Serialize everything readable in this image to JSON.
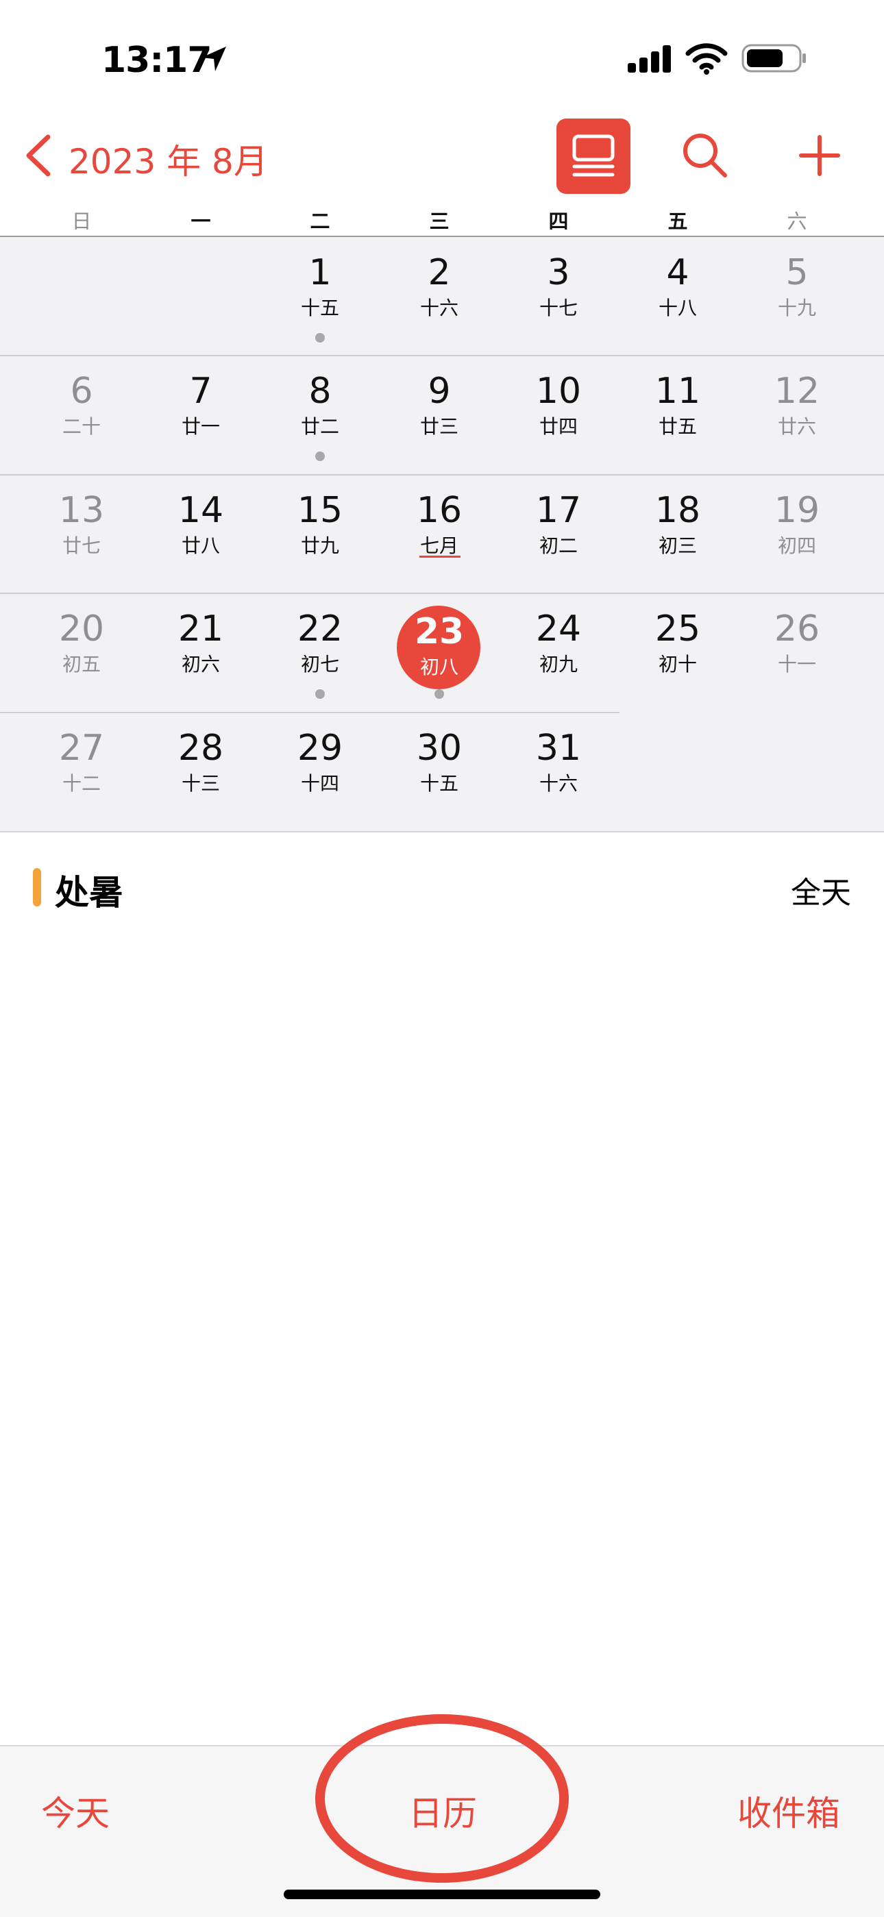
{
  "status_bar": {
    "time": "13:17",
    "location_icon": "location-arrow-icon",
    "signal_icon": "cellular-signal-icon",
    "wifi_icon": "wifi-icon",
    "battery_icon": "battery-icon"
  },
  "header": {
    "title": "2023 年 8月",
    "back_icon": "chevron-left-icon",
    "view_icon": "list-view-icon",
    "search_icon": "search-icon",
    "add_icon": "plus-icon"
  },
  "weekdays": [
    "日",
    "一",
    "二",
    "三",
    "四",
    "五",
    "六"
  ],
  "weeks": [
    [
      null,
      null,
      {
        "day": "1",
        "lunar": "十五",
        "dot": true
      },
      {
        "day": "2",
        "lunar": "十六"
      },
      {
        "day": "3",
        "lunar": "十七"
      },
      {
        "day": "4",
        "lunar": "十八"
      },
      {
        "day": "5",
        "lunar": "十九"
      }
    ],
    [
      {
        "day": "6",
        "lunar": "二十"
      },
      {
        "day": "7",
        "lunar": "廿一"
      },
      {
        "day": "8",
        "lunar": "廿二",
        "dot": true
      },
      {
        "day": "9",
        "lunar": "廿三"
      },
      {
        "day": "10",
        "lunar": "廿四"
      },
      {
        "day": "11",
        "lunar": "廿五"
      },
      {
        "day": "12",
        "lunar": "廿六"
      }
    ],
    [
      {
        "day": "13",
        "lunar": "廿七"
      },
      {
        "day": "14",
        "lunar": "廿八"
      },
      {
        "day": "15",
        "lunar": "廿九"
      },
      {
        "day": "16",
        "lunar": "七月",
        "underline": true
      },
      {
        "day": "17",
        "lunar": "初二"
      },
      {
        "day": "18",
        "lunar": "初三"
      },
      {
        "day": "19",
        "lunar": "初四"
      }
    ],
    [
      {
        "day": "20",
        "lunar": "初五"
      },
      {
        "day": "21",
        "lunar": "初六"
      },
      {
        "day": "22",
        "lunar": "初七",
        "dot": true
      },
      {
        "day": "23",
        "lunar": "初八",
        "today": true,
        "dot": true
      },
      {
        "day": "24",
        "lunar": "初九"
      },
      {
        "day": "25",
        "lunar": "初十"
      },
      {
        "day": "26",
        "lunar": "十一"
      }
    ],
    [
      {
        "day": "27",
        "lunar": "十二"
      },
      {
        "day": "28",
        "lunar": "十三"
      },
      {
        "day": "29",
        "lunar": "十四"
      },
      {
        "day": "30",
        "lunar": "十五"
      },
      {
        "day": "31",
        "lunar": "十六"
      },
      null,
      null
    ]
  ],
  "events": [
    {
      "title": "处暑",
      "time": "全天",
      "color": "#f2a43a"
    }
  ],
  "tabbar": {
    "today": "今天",
    "calendars": "日历",
    "inbox": "收件箱"
  },
  "colors": {
    "accent": "#e8473b",
    "weekend_text": "#8e8e93"
  }
}
